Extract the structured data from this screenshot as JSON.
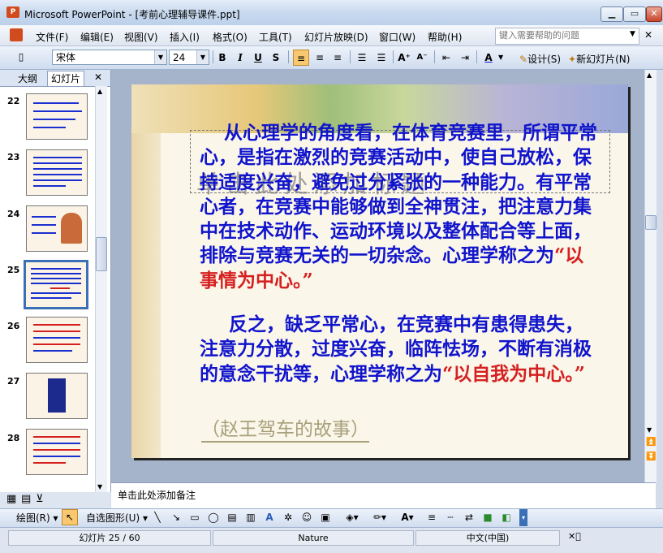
{
  "window": {
    "title": "Microsoft PowerPoint - [考前心理辅导课件.ppt]",
    "app_icon": "powerpoint-icon",
    "min_label": "▁",
    "max_label": "▭",
    "close_label": "✕"
  },
  "menu": {
    "items": [
      "文件(F)",
      "编辑(E)",
      "视图(V)",
      "插入(I)",
      "格式(O)",
      "工具(T)",
      "幻灯片放映(D)",
      "窗口(W)",
      "帮助(H)"
    ],
    "help_placeholder": "键入需要帮助的问题",
    "doc_close": "✕"
  },
  "toolbar": {
    "font_name": "宋体",
    "font_size": "24",
    "bold": "B",
    "italic": "I",
    "underline": "U",
    "shadow": "S",
    "design_label": "设计(S)",
    "new_slide_label": "新幻灯片(N)",
    "accent_color": "#f9c76f"
  },
  "left_pane": {
    "tabs": [
      "大纲",
      "幻灯片"
    ],
    "close": "✕",
    "slides": [
      {
        "num": "22"
      },
      {
        "num": "23"
      },
      {
        "num": "24"
      },
      {
        "num": "25",
        "selected": true
      },
      {
        "num": "26"
      },
      {
        "num": "27"
      },
      {
        "num": "28"
      }
    ]
  },
  "slide": {
    "placeholder": "单击此处添加标题",
    "para1": "从心理学的角度看，在体育竞赛里，所谓平常心，是指在激烈的竞赛活动中，使自己放松，保持适度兴奋，避免过分紧张的一种能力。有平常心者，在竞赛中能够做到全神贯注，把注意力集中在技术动作、运动环境以及整体配合等上面，排除与竞赛无关的一切杂念。",
    "para1_lead": "心理学称之为",
    "para1_em": "“以事情为中心。”",
    "para2": "反之，缺乏平常心，在竞赛中有患得患失，注意力分散，过度兴奋，临阵怯场，不断有消极的意念干扰等，心理学",
    "para2_lead": "称之为",
    "para2_em": "“以自我为中心。”",
    "story": "（赵王驾车的故事）",
    "text_color": "#1014cc",
    "emphasis_color": "#d52020"
  },
  "notes": {
    "placeholder": "单击此处添加备注"
  },
  "drawing": {
    "draw_label": "绘图(R)",
    "autoshape_label": "自选图形(U)"
  },
  "status": {
    "slide_info": "幻灯片 25 / 60",
    "design": "Nature",
    "language": "中文(中国)"
  }
}
